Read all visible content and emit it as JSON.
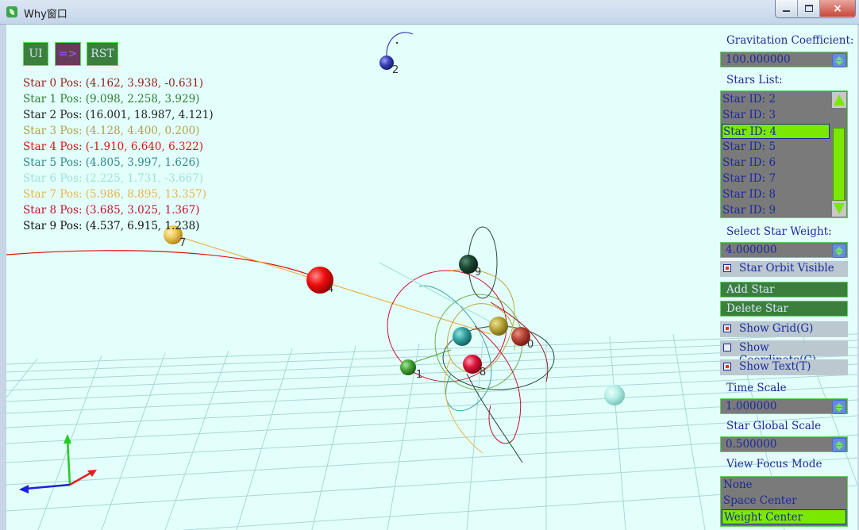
{
  "window": {
    "title": "Why窗口",
    "close_glyph": "×"
  },
  "toolbar": {
    "ui_label": "UI",
    "arrow_label": "=>",
    "reset_label": "RST"
  },
  "star_positions": [
    {
      "text": "Star 0 Pos: (4.162, 3.938, -0.631)",
      "color": "#9a1a1a"
    },
    {
      "text": "Star 1 Pos: (9.098, 2.258, 3.929)",
      "color": "#2e7d32"
    },
    {
      "text": "Star 2 Pos: (16.001, 18.987, 4.121)",
      "color": "#222222"
    },
    {
      "text": "Star 3 Pos: (4.128, 4.400, 0.200)",
      "color": "#b2a04a"
    },
    {
      "text": "Star 4 Pos: (-1.910, 6.640, 6.322)",
      "color": "#e01010"
    },
    {
      "text": "Star 5 Pos: (4.805, 3.997, 1.626)",
      "color": "#2d8a8a"
    },
    {
      "text": "Star 6 Pos: (2.225, 1.731, -3.667)",
      "color": "#9ee0d9"
    },
    {
      "text": "Star 7 Pos: (5.986, 8.895, 13.357)",
      "color": "#e6b44a"
    },
    {
      "text": "Star 8 Pos: (3.685, 3.025, 1.367)",
      "color": "#c0102a"
    },
    {
      "text": "Star 9 Pos: (4.537, 6.915, 1.238)",
      "color": "#111111"
    }
  ],
  "panel": {
    "gravitation_label": "Gravitation Coefficient:",
    "gravitation_value": "100.000000",
    "stars_list_label": "Stars List:",
    "stars_list": [
      "Star ID: 2",
      "Star ID: 3",
      "Star ID: 4",
      "Star ID: 5",
      "Star ID: 6",
      "Star ID: 7",
      "Star ID: 8",
      "Star ID: 9"
    ],
    "stars_list_selected": 2,
    "weight_label": "Select Star Weight:",
    "weight_value": "4.000000",
    "orbit_visible_label": "Star Orbit Visible",
    "add_star_label": "Add Star",
    "delete_star_label": "Delete Star",
    "show_grid_label": "Show Grid(G)",
    "show_coord_label": "Show Coordinate(C)",
    "show_text_label": "Show Text(T)",
    "time_scale_label": "Time Scale",
    "time_scale_value": "1.000000",
    "global_scale_label": "Star Global Scale",
    "global_scale_value": "0.500000",
    "focus_label": "View Focus Mode",
    "focus_options": [
      "None",
      "Space Center",
      "Weight Center"
    ],
    "focus_selected": 2
  },
  "scene_labels": {
    "star2": "2",
    "star9": "9",
    "star1": "1",
    "star0": "0",
    "star4": "4",
    "star7": "7",
    "star8": "8"
  },
  "colors": {
    "background": "#e3fffb",
    "accent_green": "#7ae800",
    "panel_text": "#1a2a9a"
  }
}
